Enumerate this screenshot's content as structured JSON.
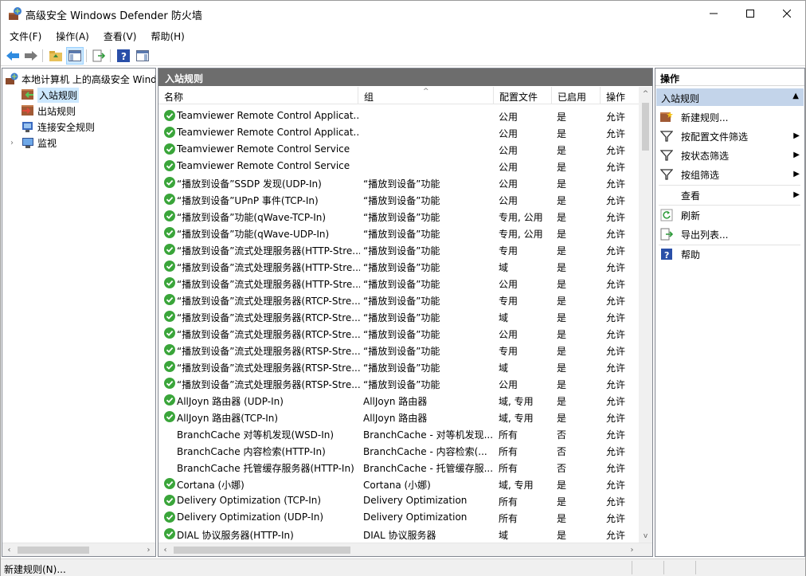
{
  "window": {
    "title": "高级安全 Windows Defender 防火墙",
    "minimize_icon": "minimize-icon",
    "maximize_icon": "maximize-icon",
    "close_icon": "close-icon"
  },
  "menu": [
    {
      "label": "文件(F)"
    },
    {
      "label": "操作(A)"
    },
    {
      "label": "查看(V)"
    },
    {
      "label": "帮助(H)"
    }
  ],
  "toolbar": {
    "icons": [
      "back-arrow-icon",
      "forward-arrow-icon",
      "folder-up-icon",
      "show-hide-tree-icon",
      "export-list-icon",
      "help-icon",
      "action-pane-icon"
    ]
  },
  "tree": {
    "root": "本地计算机 上的高级安全 Windo",
    "items": [
      {
        "label": "入站规则",
        "selected": true
      },
      {
        "label": "出站规则"
      },
      {
        "label": "连接安全规则"
      },
      {
        "label": "监视",
        "expandable": true
      }
    ]
  },
  "center": {
    "header": "入站规则",
    "columns": {
      "name": "名称",
      "group": "组",
      "profile": "配置文件",
      "enabled": "已启用",
      "action": "操作"
    },
    "rows": [
      {
        "enabled_icon": true,
        "name": "Teamviewer Remote Control Applicat...",
        "group": "",
        "profile": "公用",
        "enabled": "是",
        "action": "允许"
      },
      {
        "enabled_icon": true,
        "name": "Teamviewer Remote Control Applicat...",
        "group": "",
        "profile": "公用",
        "enabled": "是",
        "action": "允许"
      },
      {
        "enabled_icon": true,
        "name": "Teamviewer Remote Control Service",
        "group": "",
        "profile": "公用",
        "enabled": "是",
        "action": "允许"
      },
      {
        "enabled_icon": true,
        "name": "Teamviewer Remote Control Service",
        "group": "",
        "profile": "公用",
        "enabled": "是",
        "action": "允许"
      },
      {
        "enabled_icon": true,
        "name": "“播放到设备”SSDP 发现(UDP-In)",
        "group": "“播放到设备”功能",
        "profile": "公用",
        "enabled": "是",
        "action": "允许"
      },
      {
        "enabled_icon": true,
        "name": "“播放到设备”UPnP 事件(TCP-In)",
        "group": "“播放到设备”功能",
        "profile": "公用",
        "enabled": "是",
        "action": "允许"
      },
      {
        "enabled_icon": true,
        "name": "“播放到设备”功能(qWave-TCP-In)",
        "group": "“播放到设备”功能",
        "profile": "专用, 公用",
        "enabled": "是",
        "action": "允许"
      },
      {
        "enabled_icon": true,
        "name": "“播放到设备”功能(qWave-UDP-In)",
        "group": "“播放到设备”功能",
        "profile": "专用, 公用",
        "enabled": "是",
        "action": "允许"
      },
      {
        "enabled_icon": true,
        "name": "“播放到设备”流式处理服务器(HTTP-Stre...",
        "group": "“播放到设备”功能",
        "profile": "专用",
        "enabled": "是",
        "action": "允许"
      },
      {
        "enabled_icon": true,
        "name": "“播放到设备”流式处理服务器(HTTP-Stre...",
        "group": "“播放到设备”功能",
        "profile": "域",
        "enabled": "是",
        "action": "允许"
      },
      {
        "enabled_icon": true,
        "name": "“播放到设备”流式处理服务器(HTTP-Stre...",
        "group": "“播放到设备”功能",
        "profile": "公用",
        "enabled": "是",
        "action": "允许"
      },
      {
        "enabled_icon": true,
        "name": "“播放到设备”流式处理服务器(RTCP-Stre...",
        "group": "“播放到设备”功能",
        "profile": "专用",
        "enabled": "是",
        "action": "允许"
      },
      {
        "enabled_icon": true,
        "name": "“播放到设备”流式处理服务器(RTCP-Stre...",
        "group": "“播放到设备”功能",
        "profile": "域",
        "enabled": "是",
        "action": "允许"
      },
      {
        "enabled_icon": true,
        "name": "“播放到设备”流式处理服务器(RTCP-Stre...",
        "group": "“播放到设备”功能",
        "profile": "公用",
        "enabled": "是",
        "action": "允许"
      },
      {
        "enabled_icon": true,
        "name": "“播放到设备”流式处理服务器(RTSP-Stre...",
        "group": "“播放到设备”功能",
        "profile": "专用",
        "enabled": "是",
        "action": "允许"
      },
      {
        "enabled_icon": true,
        "name": "“播放到设备”流式处理服务器(RTSP-Stre...",
        "group": "“播放到设备”功能",
        "profile": "域",
        "enabled": "是",
        "action": "允许"
      },
      {
        "enabled_icon": true,
        "name": "“播放到设备”流式处理服务器(RTSP-Stre...",
        "group": "“播放到设备”功能",
        "profile": "公用",
        "enabled": "是",
        "action": "允许"
      },
      {
        "enabled_icon": true,
        "name": "AllJoyn 路由器 (UDP-In)",
        "group": "AllJoyn 路由器",
        "profile": "域, 专用",
        "enabled": "是",
        "action": "允许"
      },
      {
        "enabled_icon": true,
        "name": "AllJoyn 路由器(TCP-In)",
        "group": "AllJoyn 路由器",
        "profile": "域, 专用",
        "enabled": "是",
        "action": "允许"
      },
      {
        "enabled_icon": false,
        "name": "BranchCache 对等机发现(WSD-In)",
        "group": "BranchCache - 对等机发现...",
        "profile": "所有",
        "enabled": "否",
        "action": "允许"
      },
      {
        "enabled_icon": false,
        "name": "BranchCache 内容检索(HTTP-In)",
        "group": "BranchCache - 内容检索(...",
        "profile": "所有",
        "enabled": "否",
        "action": "允许"
      },
      {
        "enabled_icon": false,
        "name": "BranchCache 托管缓存服务器(HTTP-In)",
        "group": "BranchCache - 托管缓存服...",
        "profile": "所有",
        "enabled": "否",
        "action": "允许"
      },
      {
        "enabled_icon": true,
        "name": "Cortana (小娜)",
        "group": "Cortana (小娜)",
        "profile": "域, 专用",
        "enabled": "是",
        "action": "允许"
      },
      {
        "enabled_icon": true,
        "name": "Delivery Optimization (TCP-In)",
        "group": "Delivery Optimization",
        "profile": "所有",
        "enabled": "是",
        "action": "允许"
      },
      {
        "enabled_icon": true,
        "name": "Delivery Optimization (UDP-In)",
        "group": "Delivery Optimization",
        "profile": "所有",
        "enabled": "是",
        "action": "允许"
      },
      {
        "enabled_icon": true,
        "name": "DIAL 协议服务器(HTTP-In)",
        "group": "DIAL 协议服务器",
        "profile": "域",
        "enabled": "是",
        "action": "允许"
      }
    ]
  },
  "actions": {
    "title": "操作",
    "section": "入站规则",
    "items": [
      {
        "label": "新建规则...",
        "icon": "new-rule-icon"
      },
      {
        "label": "按配置文件筛选",
        "icon": "filter-icon",
        "submenu": true
      },
      {
        "label": "按状态筛选",
        "icon": "filter-icon",
        "submenu": true
      },
      {
        "label": "按组筛选",
        "icon": "filter-icon",
        "submenu": true
      },
      {
        "label": "查看",
        "icon": "",
        "submenu": true
      },
      {
        "label": "刷新",
        "icon": "refresh-icon"
      },
      {
        "label": "导出列表...",
        "icon": "export-list-icon"
      },
      {
        "label": "帮助",
        "icon": "help-icon"
      }
    ]
  },
  "status": {
    "text": "新建规则(N)..."
  },
  "colors": {
    "header_band": "#6d6d6d",
    "section_band": "#c3d4ea",
    "selected_tree": "#cce8ff",
    "enabled_green": "#3aa53a"
  }
}
